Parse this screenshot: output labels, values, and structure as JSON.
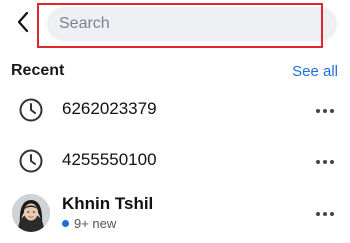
{
  "search": {
    "placeholder": "Search",
    "value": ""
  },
  "recent": {
    "title": "Recent",
    "see_all": "See all",
    "items": [
      {
        "type": "number",
        "label": "6262023379",
        "icon": "clock-icon"
      },
      {
        "type": "number",
        "label": "4255550100",
        "icon": "clock-icon"
      },
      {
        "type": "contact",
        "label": "Khnin Tshil",
        "sublabel": "9+ new",
        "icon": "avatar"
      }
    ]
  },
  "colors": {
    "accent": "#1e6fd9",
    "highlight": "#e0262e",
    "search_bg": "#eeeff3"
  }
}
